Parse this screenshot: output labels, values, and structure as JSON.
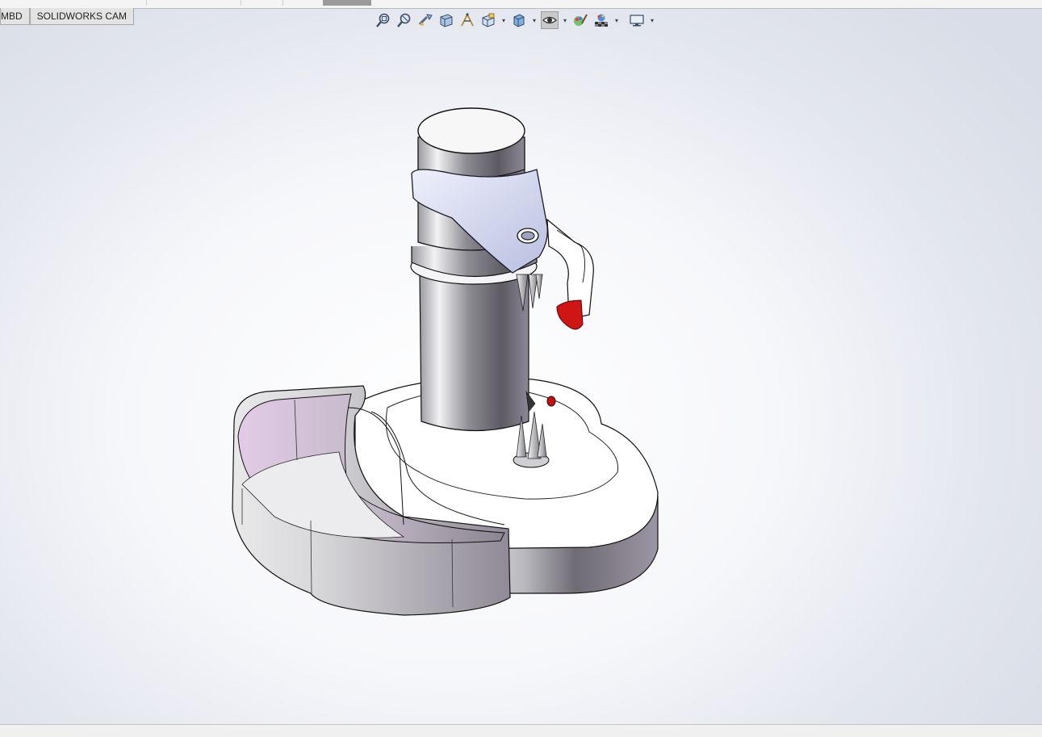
{
  "command_manager": {
    "tabs": [
      {
        "label": "MBD"
      },
      {
        "label": "SOLIDWORKS CAM"
      }
    ]
  },
  "heads_up_toolbar": {
    "tools": [
      "zoom-to-fit-icon",
      "zoom-to-area-icon",
      "previous-view-icon",
      "section-view-icon",
      "dynamic-annotation-icon",
      "view-orientation-icon",
      "display-style-icon",
      "hide-show-items-icon",
      "edit-appearance-icon",
      "apply-scene-icon",
      "view-settings-icon"
    ],
    "active_tool": "hide-show-items-icon"
  },
  "colors": {
    "accent_red": "#d01515",
    "part_lavender": "#d8dcf2",
    "viewport_bg": "#eef0f5"
  }
}
